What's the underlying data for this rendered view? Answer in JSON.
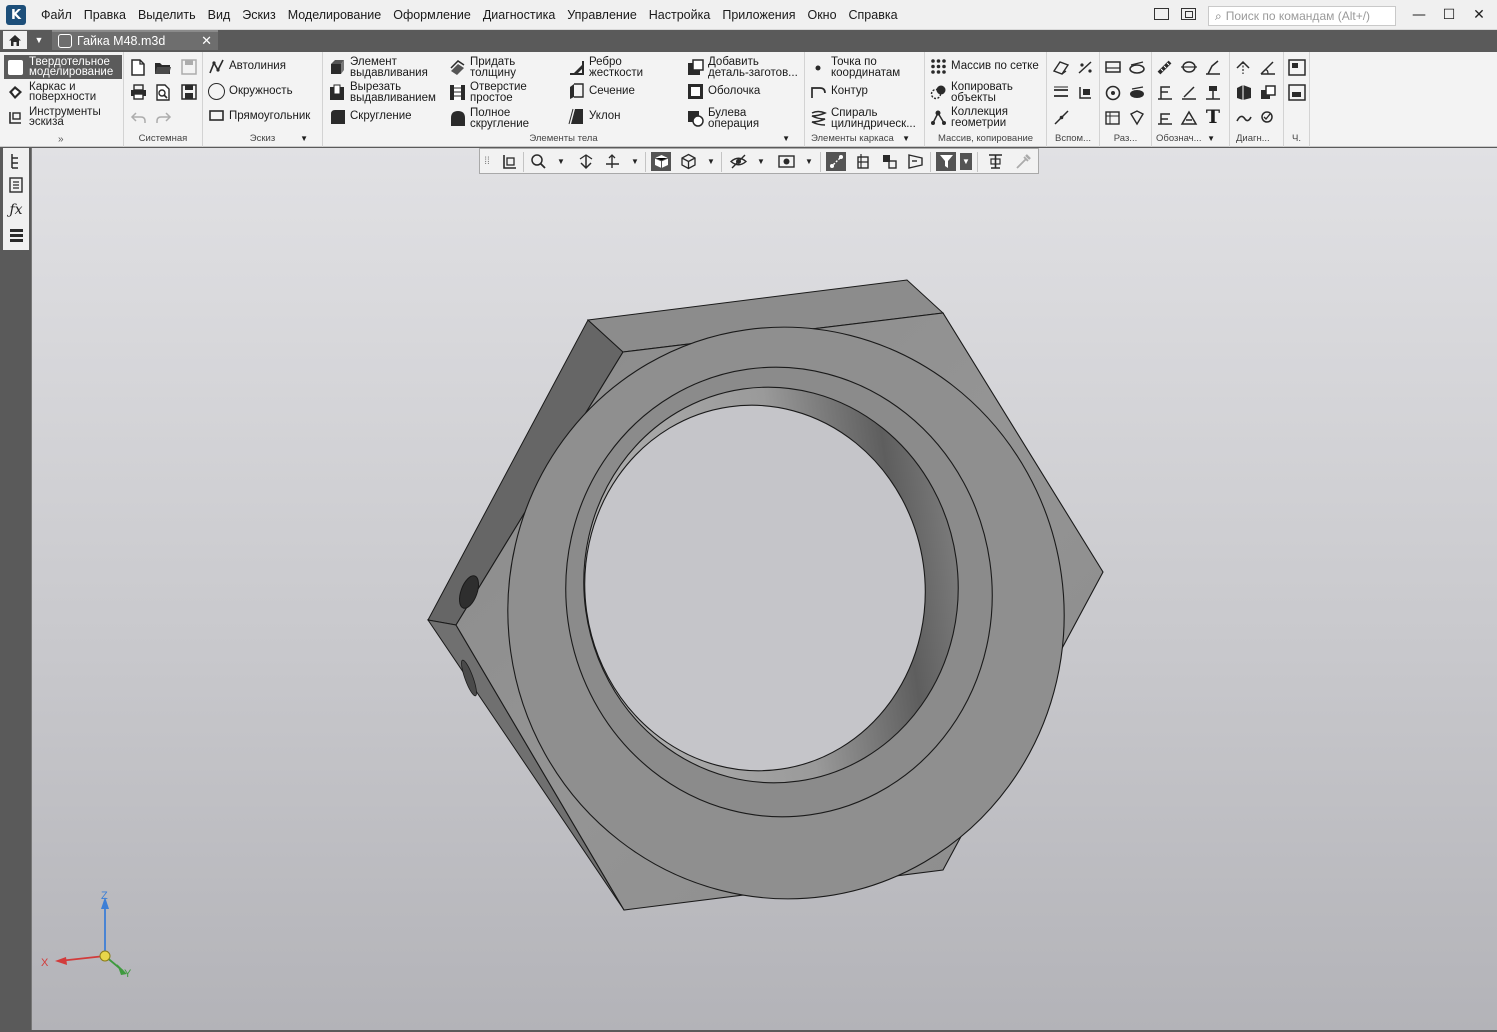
{
  "app": {
    "logo_letter": "K"
  },
  "menu": [
    "Файл",
    "Правка",
    "Выделить",
    "Вид",
    "Эскиз",
    "Моделирование",
    "Оформление",
    "Диагностика",
    "Управление",
    "Настройка",
    "Приложения",
    "Окно",
    "Справка"
  ],
  "search": {
    "placeholder": "Поиск по командам (Alt+/)"
  },
  "window_controls": {
    "minimize": "—",
    "maximize": "☐",
    "close": "✕"
  },
  "tabs": {
    "document": "Гайка М48.m3d",
    "close": "✕"
  },
  "ribbon": {
    "modes": [
      {
        "label": "Твердотельное моделирование",
        "active": true
      },
      {
        "label": "Каркас и поверхности",
        "active": false
      },
      {
        "label": "Инструменты эскиза",
        "active": false
      }
    ],
    "groups": {
      "system": "Системная",
      "sketch": "Эскиз",
      "body": "Элементы тела",
      "wire": "Элементы каркаса",
      "array": "Массив, копирование",
      "aux": "Вспом...",
      "dims": "Раз...",
      "notation": "Обознач...",
      "diag": "Диагн...",
      "ch": "Ч."
    },
    "sketch_tools": [
      "Автолиния",
      "Окружность",
      "Прямоугольник"
    ],
    "body_tools": {
      "col1": [
        "Элемент выдавливания",
        "Вырезать выдавливанием",
        "Скругление"
      ],
      "col2": [
        "Придать толщину",
        "Отверстие простое",
        "Полное скругление"
      ],
      "col3": [
        "Ребро жесткости",
        "Сечение",
        "Уклон"
      ],
      "col4": [
        "Добавить деталь-заготов...",
        "Оболочка",
        "Булева операция"
      ]
    },
    "wire_tools": [
      "Точка по координатам",
      "Контур",
      "Спираль цилиндрическ..."
    ],
    "array_tools": [
      "Массив по сетке",
      "Копировать объекты",
      "Коллекция геометрии"
    ]
  },
  "triad": {
    "x": "X",
    "y": "Y",
    "z": "Z"
  },
  "colors": {
    "accent_dark": "#5b5b5b",
    "model_face": "#8e8e8e",
    "triad_x": "#d23b3b",
    "triad_y": "#3f9a3f",
    "triad_z": "#3d7fd6"
  },
  "icons": [
    "home-icon",
    "document-icon",
    "new-file-icon",
    "open-folder-icon",
    "save-icon",
    "print-icon",
    "preview-icon",
    "undo-icon",
    "redo-icon",
    "tree-icon",
    "properties-icon",
    "fx-icon",
    "layers-icon",
    "filter-icon",
    "cube-icon"
  ]
}
